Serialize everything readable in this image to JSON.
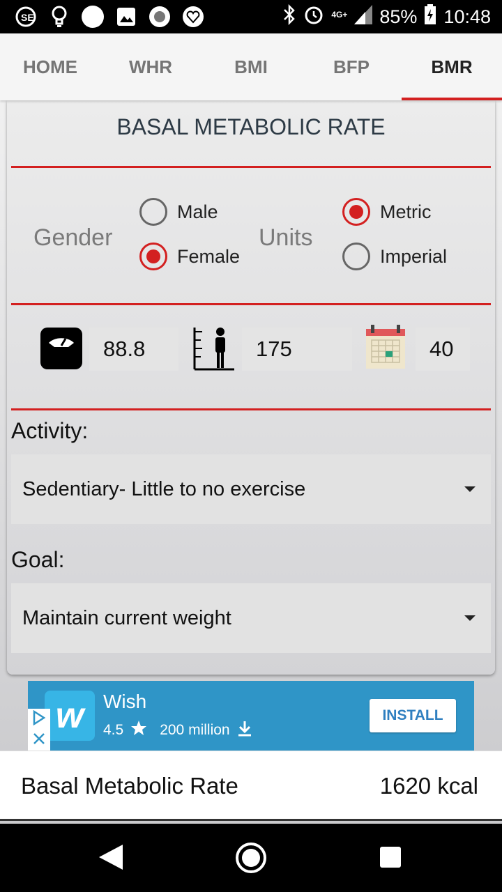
{
  "status_bar": {
    "network": "4G+",
    "battery": "85%",
    "time": "10:48",
    "icons": [
      "se-icon",
      "lightbulb-icon",
      "circle-icon",
      "image-icon",
      "record-icon",
      "heart-badge-icon",
      "bluetooth-icon",
      "alarm-icon",
      "signal-icon",
      "battery-charging-icon"
    ]
  },
  "tabs": [
    {
      "label": "HOME",
      "active": false
    },
    {
      "label": "WHR",
      "active": false
    },
    {
      "label": "BMI",
      "active": false
    },
    {
      "label": "BFP",
      "active": false
    },
    {
      "label": "BMR",
      "active": true
    }
  ],
  "card": {
    "title": "BASAL METABOLIC RATE",
    "gender": {
      "label": "Gender",
      "options": [
        {
          "label": "Male",
          "selected": false
        },
        {
          "label": "Female",
          "selected": true
        }
      ]
    },
    "units": {
      "label": "Units",
      "options": [
        {
          "label": "Metric",
          "selected": true
        },
        {
          "label": "Imperial",
          "selected": false
        }
      ]
    },
    "inputs": {
      "weight": "88.8",
      "height": "175",
      "age": "40"
    },
    "activity": {
      "label": "Activity:",
      "selected": "Sedentiary- Little to no exercise"
    },
    "goal": {
      "label": "Goal:",
      "selected": "Maintain current weight"
    }
  },
  "ad": {
    "app_name": "Wish",
    "logo_letter": "w",
    "rating": "4.5",
    "downloads": "200 million",
    "button": "INSTALL"
  },
  "result": {
    "label": "Basal Metabolic Rate",
    "value": "1620 kcal"
  },
  "colors": {
    "accent": "#d32020",
    "ad_bg": "#2f95c7"
  }
}
